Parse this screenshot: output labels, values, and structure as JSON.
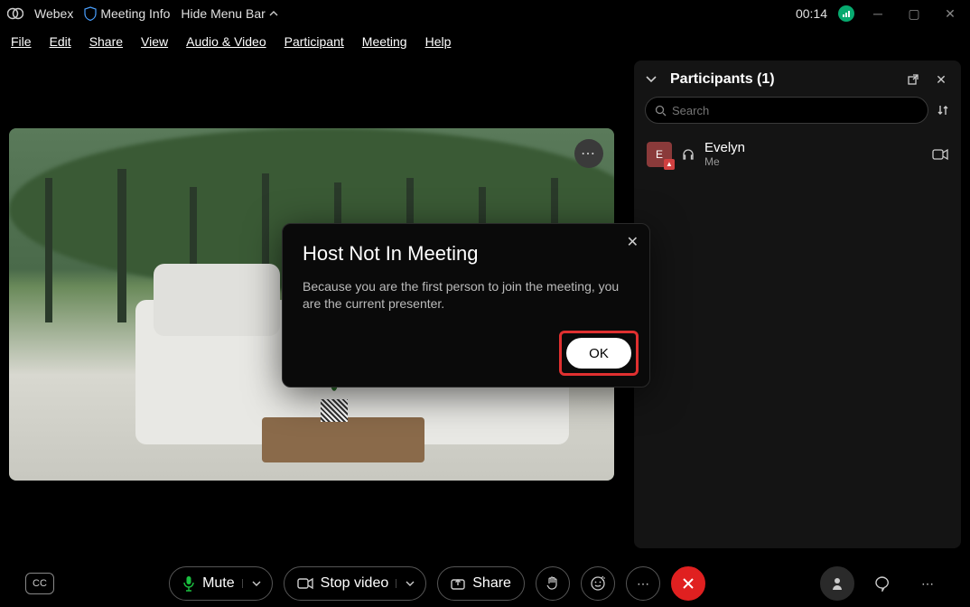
{
  "titlebar": {
    "app_name": "Webex",
    "meeting_info": "Meeting Info",
    "hide_menu": "Hide Menu Bar",
    "time": "00:14"
  },
  "menubar": {
    "file": "File",
    "edit": "Edit",
    "share": "Share",
    "view": "View",
    "audio_video": "Audio & Video",
    "participant": "Participant",
    "meeting": "Meeting",
    "help": "Help"
  },
  "participants_panel": {
    "title": "Participants (1)",
    "search_placeholder": "Search",
    "list": [
      {
        "name": "Evelyn",
        "sub": "Me",
        "avatar_initial": "E"
      }
    ]
  },
  "dialog": {
    "title": "Host Not In Meeting",
    "message": "Because you are the first person to join the meeting, you are the current presenter.",
    "ok": "OK"
  },
  "controls": {
    "cc": "CC",
    "mute": "Mute",
    "stop_video": "Stop video",
    "share": "Share"
  }
}
